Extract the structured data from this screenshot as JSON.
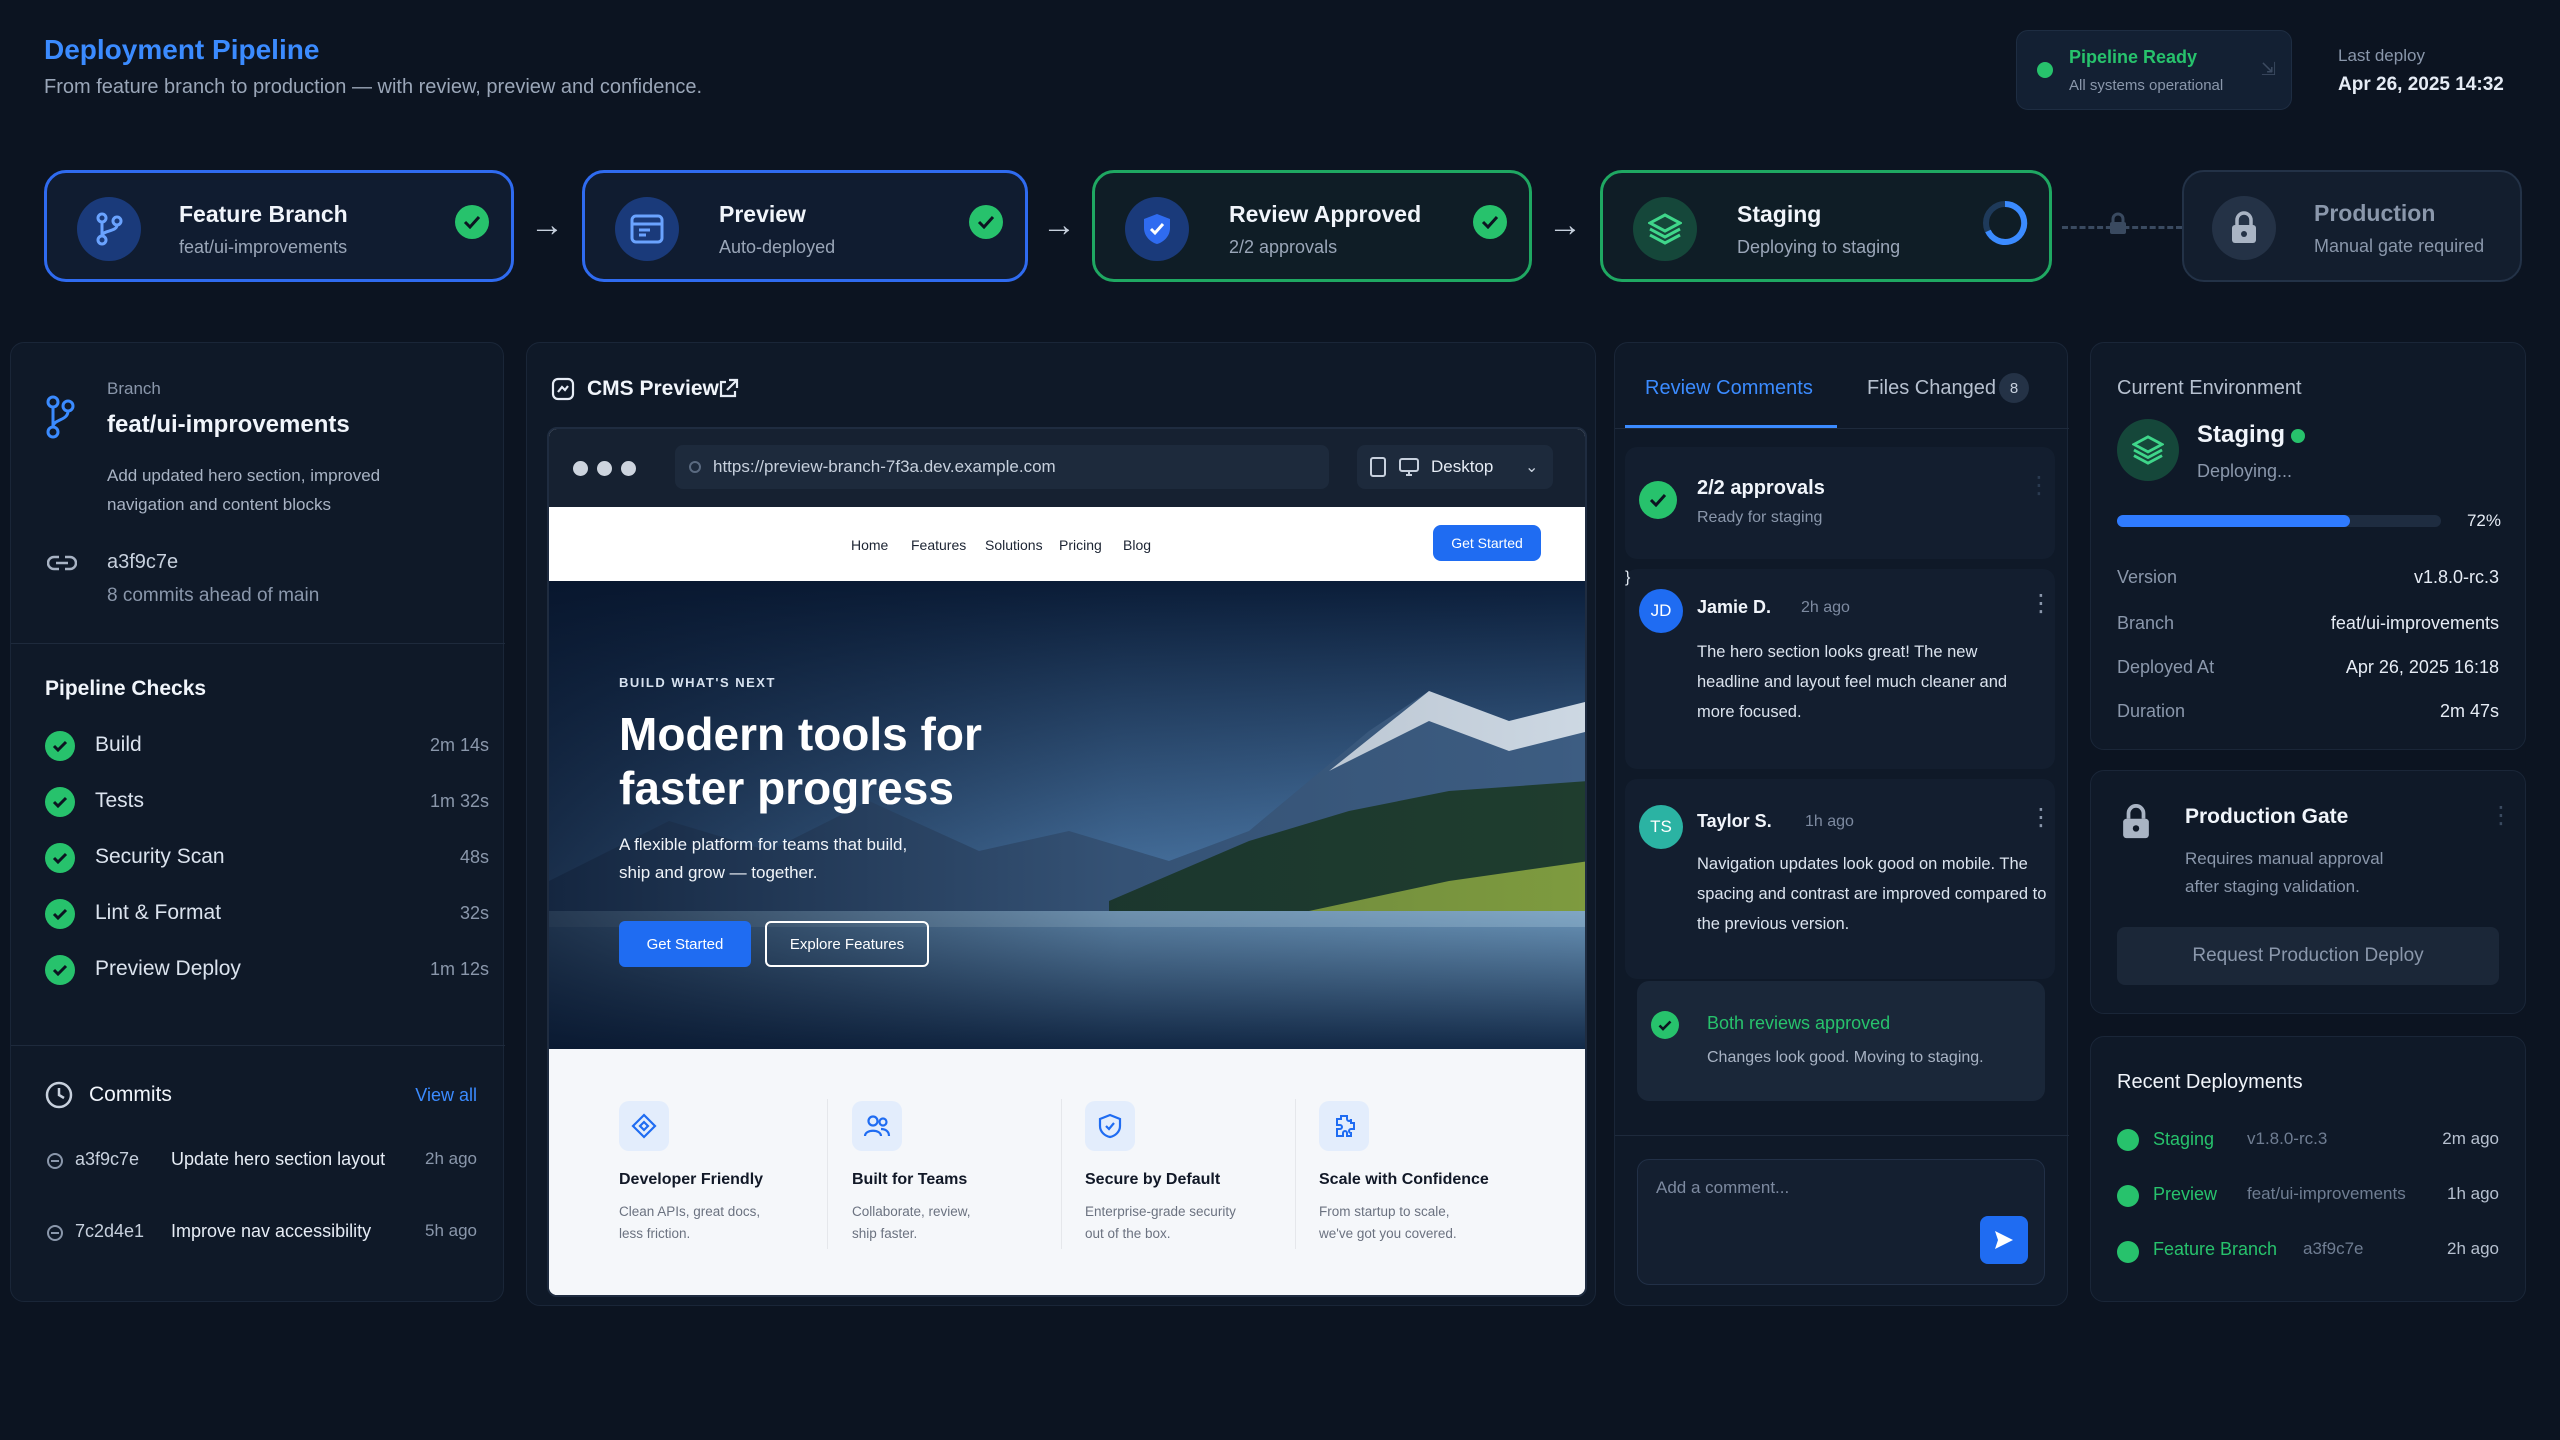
{
  "header": {
    "title": "Deployment Pipeline",
    "subtitle": "From feature branch to production — with review, preview and confidence.",
    "status_title": "Pipeline Ready",
    "status_sub": "All systems operational",
    "last_deploy_label": "Last deploy",
    "last_deploy_value": "Apr 26, 2025 14:32"
  },
  "stages": [
    {
      "title": "Feature Branch",
      "sub": "feat/ui-improvements",
      "icon": "git-branch-icon",
      "state": "done"
    },
    {
      "title": "Preview",
      "sub": "Auto-deployed",
      "icon": "browser-window-icon",
      "state": "done"
    },
    {
      "title": "Review Approved",
      "sub": "2/2 approvals",
      "icon": "shield-check-icon",
      "state": "done"
    },
    {
      "title": "Staging",
      "sub": "Deploying to staging",
      "icon": "layers-icon",
      "state": "in-progress"
    },
    {
      "title": "Production",
      "sub": "Manual gate required",
      "icon": "lock-icon",
      "state": "locked"
    }
  ],
  "branch": {
    "label": "Branch",
    "name": "feat/ui-improvements",
    "desc": "Add updated hero section, improved navigation and content blocks",
    "commit": "a3f9c7e",
    "ahead": "8 commits ahead of main"
  },
  "checks": {
    "title": "Pipeline Checks",
    "items": [
      {
        "name": "Build",
        "time": "2m 14s"
      },
      {
        "name": "Tests",
        "time": "1m 32s"
      },
      {
        "name": "Security Scan",
        "time": "48s"
      },
      {
        "name": "Lint & Format",
        "time": "32s"
      },
      {
        "name": "Preview Deploy",
        "time": "1m 12s"
      }
    ]
  },
  "commits": {
    "title": "Commits",
    "view_all": "View all",
    "items": [
      {
        "hash": "a3f9c7e",
        "msg": "Update hero section layout",
        "time": "2h ago"
      },
      {
        "hash": "7c2d4e1",
        "msg": "Improve nav accessibility",
        "time": "5h ago"
      }
    ]
  },
  "preview": {
    "title": "CMS Preview",
    "url": "https://preview-branch-7f3a.dev.example.com",
    "device": "Desktop",
    "nav": [
      "Home",
      "Features",
      "Solutions",
      "Pricing",
      "Blog"
    ],
    "nav_cta": "Get Started",
    "eyebrow": "BUILD WHAT'S NEXT",
    "hero_line1": "Modern tools for",
    "hero_line2": "faster progress",
    "hero_desc1": "A flexible platform for teams that build,",
    "hero_desc2": "ship and grow — together.",
    "cta_primary": "Get Started",
    "cta_secondary": "Explore Features",
    "features": [
      {
        "title": "Developer Friendly",
        "desc": "Clean APIs, great docs,\nless friction.",
        "icon": "code-icon"
      },
      {
        "title": "Built for Teams",
        "desc": "Collaborate, review,\nship faster.",
        "icon": "users-icon"
      },
      {
        "title": "Secure by Default",
        "desc": "Enterprise-grade security\nout of the box.",
        "icon": "shield-icon"
      },
      {
        "title": "Scale with Confidence",
        "desc": "From startup to scale,\nwe've got you covered.",
        "icon": "puzzle-icon"
      }
    ]
  },
  "review": {
    "tab_comments": "Review Comments",
    "tab_files": "Files Changed",
    "files_count": "8",
    "approvals_title": "2/2 approvals",
    "approvals_sub": "Ready for staging",
    "comments": [
      {
        "initials": "JD",
        "name": "Jamie D.",
        "time": "2h ago",
        "text": "The hero section looks great! The new headline and layout feel much cleaner and more focused.",
        "color": "#1f6cf2"
      },
      {
        "initials": "TS",
        "name": "Taylor S.",
        "time": "1h ago",
        "text": "Navigation updates look good on mobile. The spacing and contrast are improved compared to the previous version.",
        "color": "#2bb3a3"
      }
    ],
    "summary_title": "Both reviews approved",
    "summary_sub": "Changes look good. Moving to staging.",
    "comment_placeholder": "Add a comment..."
  },
  "environment": {
    "label": "Current Environment",
    "name": "Staging",
    "status": "Deploying...",
    "progress": 72,
    "progress_label": "72%",
    "rows": [
      {
        "k": "Version",
        "v": "v1.8.0-rc.3"
      },
      {
        "k": "Branch",
        "v": "feat/ui-improvements"
      },
      {
        "k": "Deployed At",
        "v": "Apr 26, 2025 16:18"
      },
      {
        "k": "Duration",
        "v": "2m 47s"
      }
    ]
  },
  "gate": {
    "title": "Production Gate",
    "desc1": "Requires manual approval",
    "desc2": "after staging validation.",
    "button": "Request Production Deploy"
  },
  "recent": {
    "title": "Recent Deployments",
    "items": [
      {
        "env": "Staging",
        "ref": "v1.8.0-rc.3",
        "time": "2m ago"
      },
      {
        "env": "Preview",
        "ref": "feat/ui-improvements",
        "time": "1h ago"
      },
      {
        "env": "Feature Branch",
        "ref": "a3f9c7e",
        "time": "2h ago"
      }
    ]
  },
  "colors": {
    "accent": "#3b8bff",
    "success": "#27c26c",
    "background": "#0c1421"
  }
}
